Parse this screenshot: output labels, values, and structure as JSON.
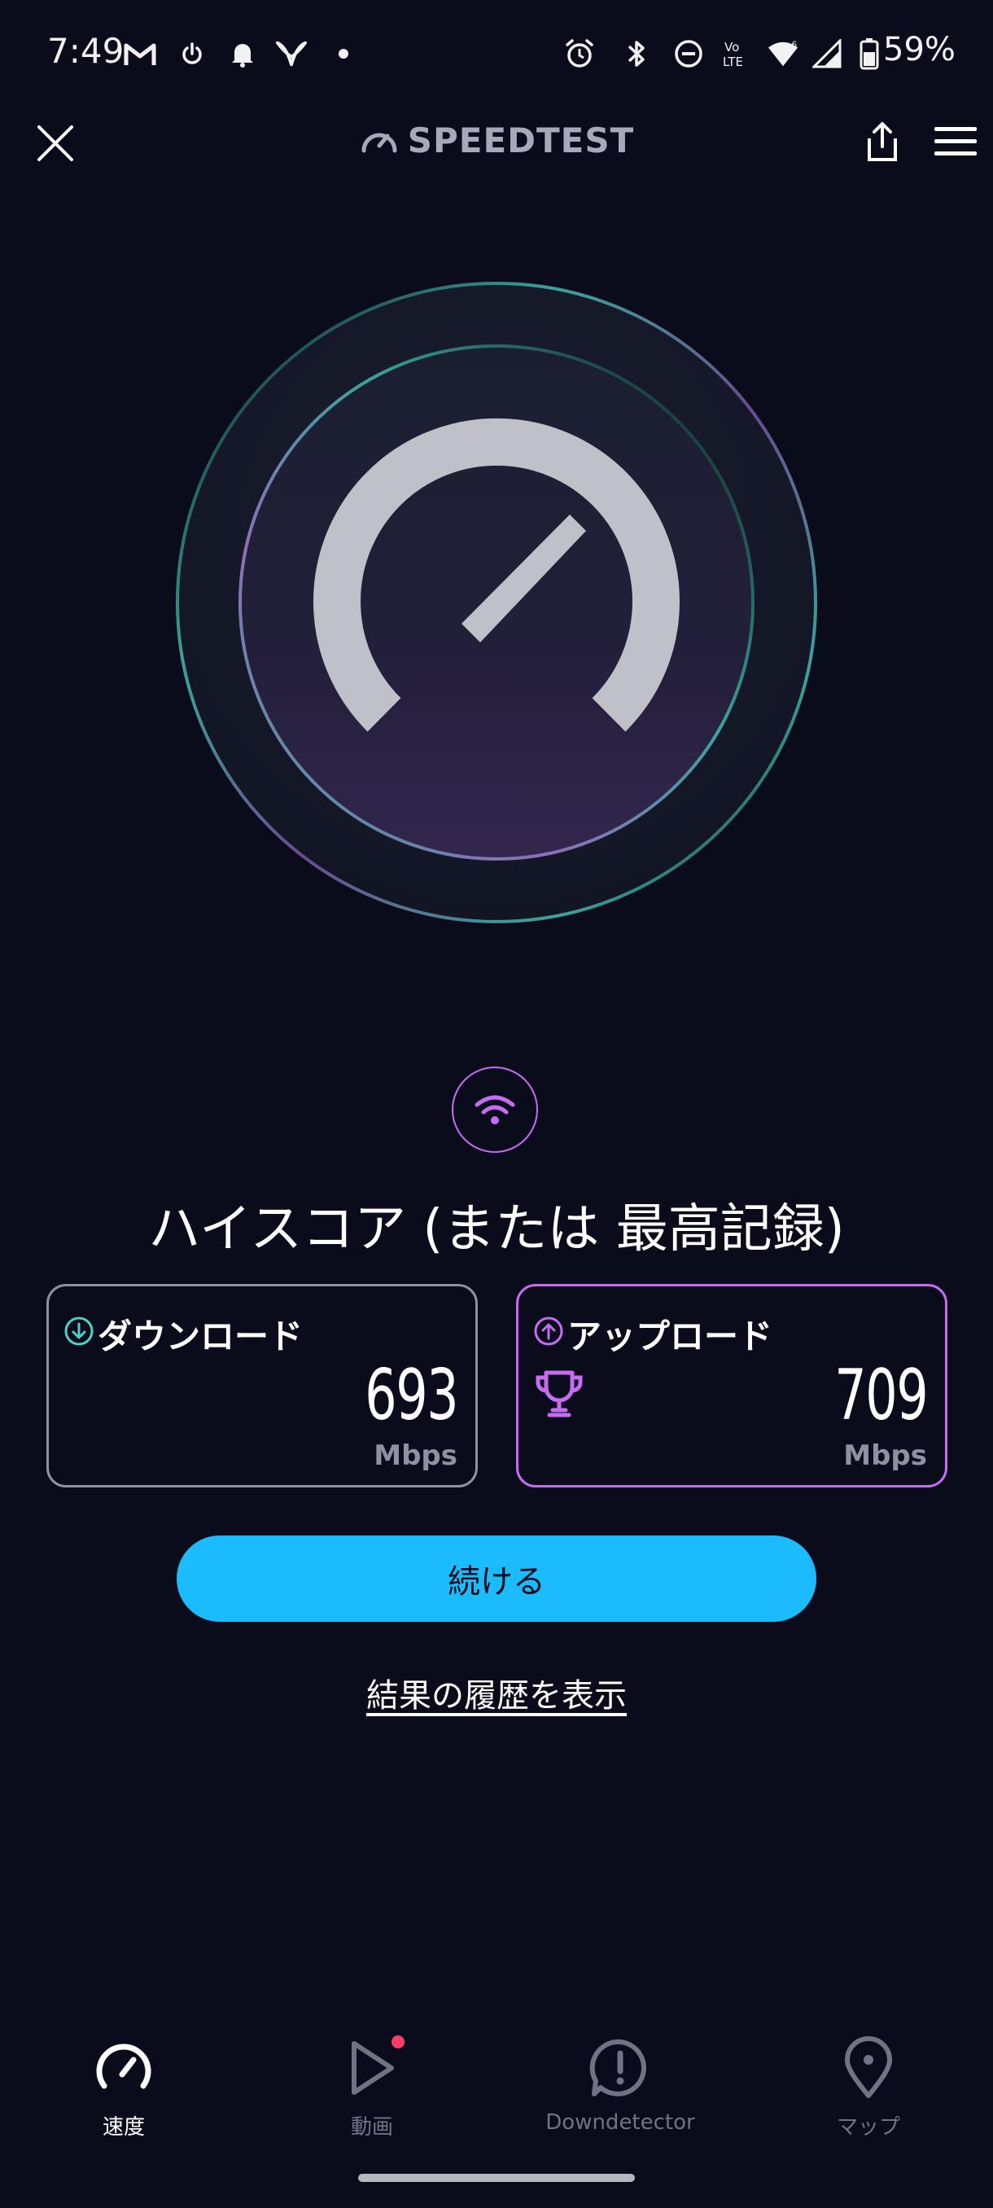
{
  "status_bar": {
    "time": "7:49",
    "battery": "59%",
    "icons": [
      "gmail-icon",
      "power-icon",
      "bell-icon",
      "vpn-icon",
      "dot-icon",
      "alarm-icon",
      "bluetooth-icon",
      "dnd-icon",
      "volte-icon",
      "wifi-icon",
      "signal-icon",
      "battery-icon"
    ]
  },
  "header": {
    "title": "SPEEDTEST"
  },
  "gauge": {
    "accent_teal": "#3aa39a",
    "accent_purple": "#6b4a8e",
    "needle_level": 0.78
  },
  "result": {
    "title": "ハイスコア (または 最高記録)",
    "download": {
      "label": "ダウンロード",
      "value": "693",
      "unit": "Mbps",
      "color": "#4fd1c5"
    },
    "upload": {
      "label": "アップロード",
      "value": "709",
      "unit": "Mbps",
      "color": "#c56cf0"
    }
  },
  "actions": {
    "continue_label": "続ける",
    "history_label": "結果の履歴を表示"
  },
  "bottom_nav": {
    "items": [
      {
        "label": "速度",
        "active": true
      },
      {
        "label": "動画",
        "active": false,
        "badge": true
      },
      {
        "label": "Downdetector",
        "active": false
      },
      {
        "label": "マップ",
        "active": false
      }
    ]
  },
  "colors": {
    "background": "#0b0c1b",
    "button": "#1abcfe",
    "notification_dot": "#ff3b6b"
  }
}
